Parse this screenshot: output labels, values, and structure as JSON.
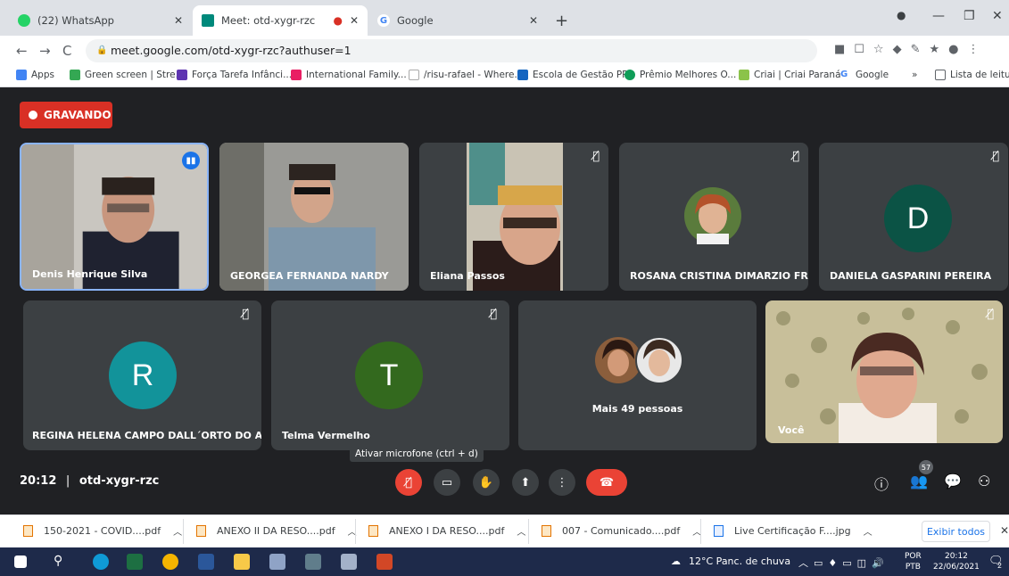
{
  "browser": {
    "tabs": [
      {
        "title": "(22) WhatsApp",
        "active": false
      },
      {
        "title": "Meet: otd-xygr-rzc",
        "active": true
      },
      {
        "title": "Google",
        "active": false
      }
    ],
    "url": "meet.google.com/otd-xygr-rzc?authuser=1",
    "bookmarks": [
      "Apps",
      "Green screen | Stre...",
      "Força Tarefa Infânci...",
      "International Family...",
      "/risu-rafael - Where...",
      "Escola de Gestão PR",
      "Prêmio Melhores O...",
      "Criai | Criai Paraná",
      "Google"
    ],
    "reading_list": "Lista de leitura",
    "more_bookmarks": "»"
  },
  "meet": {
    "recording_label": "GRAVANDO",
    "participants": [
      {
        "name": "Denis Henrique Silva"
      },
      {
        "name": "GEORGEA FERNANDA NARDY"
      },
      {
        "name": "Eliana Passos"
      },
      {
        "name": "ROSANA CRISTINA DIMARZIO FR..."
      },
      {
        "name": "DANIELA GASPARINI PEREIRA",
        "initial": "D"
      },
      {
        "name": "REGINA HELENA CAMPO DALL´ORTO DO A...",
        "initial": "R"
      },
      {
        "name": "Telma Vermelho",
        "initial": "T"
      },
      {
        "name": "Mais 49 pessoas"
      },
      {
        "name": "Você"
      }
    ],
    "tooltip": "Ativar microfone (ctrl + d)",
    "time": "20:12",
    "separator": "|",
    "meeting_code": "otd-xygr-rzc",
    "participant_count": "57",
    "colors": {
      "record": "#d93025",
      "end_call": "#ea4335",
      "avatar_d": "#0b5345",
      "avatar_r": "#12939a",
      "avatar_t": "#33691e"
    }
  },
  "downloads": {
    "items": [
      "150-2021 - COVID....pdf",
      "ANEXO II DA RESO....pdf",
      "ANEXO I DA RESO....pdf",
      "007 - Comunicado....pdf",
      "Live Certificação F....jpg"
    ],
    "show_all": "Exibir todos"
  },
  "taskbar": {
    "weather": "12°C  Panc. de chuva",
    "lang_top": "POR",
    "lang_bottom": "PTB",
    "time": "20:12",
    "date": "22/06/2021",
    "notifications": "2"
  }
}
